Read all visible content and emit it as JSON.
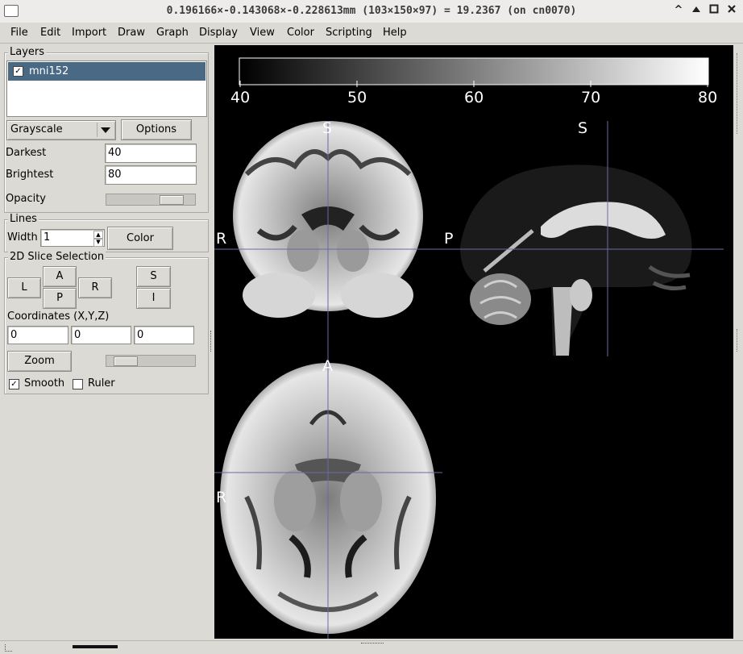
{
  "window": {
    "title": "0.196166×-0.143068×-0.228613mm (103×150×97) =  19.2367 (on cn0070)",
    "buttons": {
      "minimize": "^",
      "maximize": "▲",
      "restore": "□",
      "close": "✕"
    }
  },
  "menu": [
    "File",
    "Edit",
    "Import",
    "Draw",
    "Graph",
    "Display",
    "View",
    "Color",
    "Scripting",
    "Help"
  ],
  "layers": {
    "title": "Layers",
    "items": [
      {
        "label": "mni152",
        "checked": true
      }
    ],
    "colormap": "Grayscale",
    "options_label": "Options",
    "darkest_label": "Darkest",
    "darkest_value": "40",
    "brightest_label": "Brightest",
    "brightest_value": "80",
    "opacity_label": "Opacity",
    "opacity_level": 0.85
  },
  "lines": {
    "title": "Lines",
    "width_label": "Width",
    "width_value": "1",
    "color_label": "Color"
  },
  "slice": {
    "title": "2D Slice Selection",
    "buttons": {
      "L": "L",
      "A": "A",
      "P": "P",
      "R": "R",
      "S": "S",
      "I": "I"
    },
    "coords_label": "Coordinates (X,Y,Z)",
    "x": "0",
    "y": "0",
    "z": "0",
    "zoom_label": "Zoom",
    "zoom_level": 0.12,
    "smooth_label": "Smooth",
    "smooth_checked": true,
    "ruler_label": "Ruler",
    "ruler_checked": false
  },
  "viewer": {
    "colorbar_ticks": [
      "40",
      "50",
      "60",
      "70",
      "80"
    ],
    "coronal": {
      "top": "S",
      "left": "R"
    },
    "sagittal": {
      "top": "S",
      "left": "P"
    },
    "axial": {
      "top": "A",
      "left": "R"
    }
  },
  "colors": {
    "selection": "#4a6984",
    "crosshair": "#6b6ba6",
    "background": "#dcdad5"
  }
}
